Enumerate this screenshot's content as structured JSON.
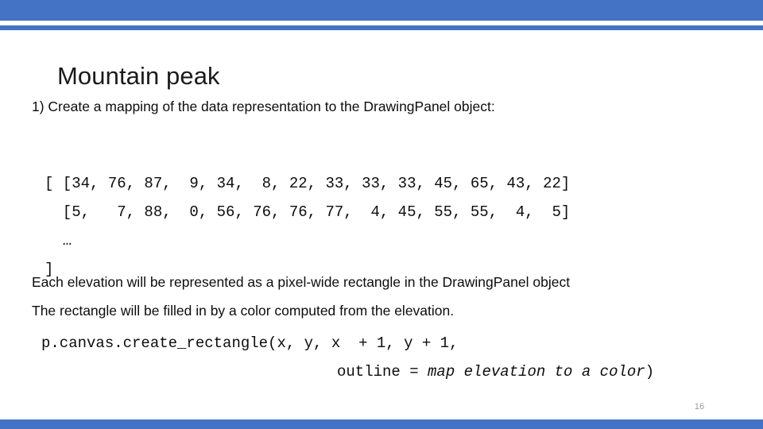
{
  "theme": {
    "accent_color": "#4472C4",
    "text_color": "#0D0D0D",
    "page_number_color": "#9A9A9A",
    "background": "#FFFFFF"
  },
  "slide": {
    "title": "Mountain peak",
    "page_number": "16",
    "body": {
      "intro": "1) Create a mapping of the data representation to the DrawingPanel object:",
      "note_each": "Each elevation will be represented as a pixel-wide rectangle in the DrawingPanel object",
      "note_rect": "The rectangle will be filled in by a color computed from the elevation."
    },
    "data_listing": {
      "line1": "[ [34, 76, 87,  9, 34,  8, 22, 33, 33, 33, 45, 65, 43, 22]",
      "line2": "  [5,   7, 88,  0, 56, 76, 76, 77,  4, 45, 55, 55,  4,  5]",
      "ellipsis": "  …",
      "closing": "]",
      "rows": [
        [
          34,
          76,
          87,
          9,
          34,
          8,
          22,
          33,
          33,
          33,
          45,
          65,
          43,
          22
        ],
        [
          5,
          7,
          88,
          0,
          56,
          76,
          76,
          77,
          4,
          45,
          55,
          55,
          4,
          5
        ]
      ]
    },
    "code": {
      "line1": "p.canvas.create_rectangle(x, y, x  + 1, y + 1,",
      "line2_prefix": "outline = ",
      "line2_italic": "map elevation to a color",
      "line2_suffix": ")"
    }
  }
}
